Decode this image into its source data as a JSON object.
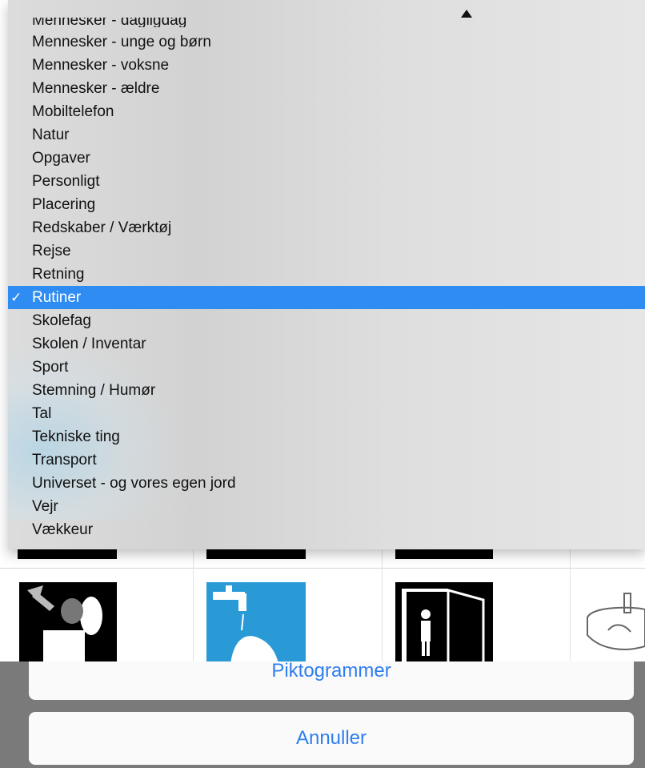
{
  "menu": {
    "partial_item": "Mennesker - dagligdag",
    "items": [
      {
        "label": "Mennesker - unge og børn"
      },
      {
        "label": "Mennesker - voksne"
      },
      {
        "label": "Mennesker - ældre"
      },
      {
        "label": "Mobiltelefon"
      },
      {
        "label": "Natur"
      },
      {
        "label": "Opgaver"
      },
      {
        "label": "Personligt"
      },
      {
        "label": "Placering"
      },
      {
        "label": "Redskaber / Værktøj"
      },
      {
        "label": "Rejse"
      },
      {
        "label": "Retning"
      },
      {
        "label": "Rutiner"
      },
      {
        "label": "Skolefag"
      },
      {
        "label": "Skolen / Inventar"
      },
      {
        "label": "Sport"
      },
      {
        "label": "Stemning / Humør"
      },
      {
        "label": "Tal"
      },
      {
        "label": "Tekniske ting"
      },
      {
        "label": "Transport"
      },
      {
        "label": "Universet - og vores egen jord"
      },
      {
        "label": "Vejr"
      },
      {
        "label": "Vækkeur"
      }
    ],
    "selected_index": 11,
    "checkmark": "✓",
    "selected_color": "#2f8cf2"
  },
  "sheet": {
    "primary_label": "Piktogrammer",
    "cancel_label": "Annuller",
    "accent_color": "#2f7ef0"
  },
  "pictograms": [
    {
      "icon": "trash-bin-icon"
    },
    {
      "icon": "hand-washing-icon"
    },
    {
      "icon": "toilet-door-icon"
    },
    {
      "icon": "sink-icon"
    }
  ]
}
